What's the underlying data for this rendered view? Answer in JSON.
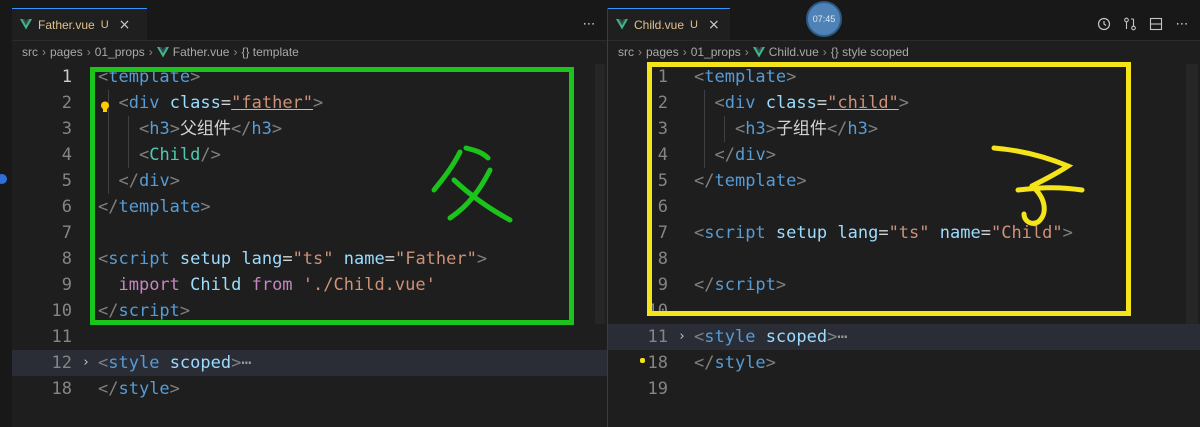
{
  "left": {
    "tab": {
      "name": "Father.vue",
      "status": "U"
    },
    "breadcrumb": [
      "src",
      "pages",
      "01_props",
      "Father.vue",
      "{} template"
    ],
    "lines": [
      {
        "n": "1",
        "tokens": [
          [
            "b",
            "<"
          ],
          [
            "tag",
            "template"
          ],
          [
            "b",
            ">"
          ]
        ]
      },
      {
        "n": "2",
        "tokens": [
          [
            "txt",
            "  "
          ],
          [
            "b",
            "<"
          ],
          [
            "tag",
            "div"
          ],
          [
            "txt",
            " "
          ],
          [
            "attr",
            "class"
          ],
          [
            "txt",
            "="
          ],
          [
            "strU",
            "\"father\""
          ],
          [
            "b",
            ">"
          ]
        ]
      },
      {
        "n": "3",
        "tokens": [
          [
            "txt",
            "    "
          ],
          [
            "b",
            "<"
          ],
          [
            "tag",
            "h3"
          ],
          [
            "b",
            ">"
          ],
          [
            "txt",
            "父组件"
          ],
          [
            "b",
            "</"
          ],
          [
            "tag",
            "h3"
          ],
          [
            "b",
            ">"
          ]
        ]
      },
      {
        "n": "4",
        "tokens": [
          [
            "txt",
            "    "
          ],
          [
            "b",
            "<"
          ],
          [
            "comp",
            "Child"
          ],
          [
            "b",
            "/>"
          ]
        ]
      },
      {
        "n": "5",
        "tokens": [
          [
            "txt",
            "  "
          ],
          [
            "b",
            "</"
          ],
          [
            "tag",
            "div"
          ],
          [
            "b",
            ">"
          ]
        ]
      },
      {
        "n": "6",
        "tokens": [
          [
            "b",
            "</"
          ],
          [
            "tag",
            "template"
          ],
          [
            "b",
            ">"
          ]
        ]
      },
      {
        "n": "7",
        "tokens": []
      },
      {
        "n": "8",
        "tokens": [
          [
            "b",
            "<"
          ],
          [
            "tag",
            "script"
          ],
          [
            "txt",
            " "
          ],
          [
            "attr",
            "setup"
          ],
          [
            "txt",
            " "
          ],
          [
            "attr",
            "lang"
          ],
          [
            "txt",
            "="
          ],
          [
            "str",
            "\"ts\""
          ],
          [
            "txt",
            " "
          ],
          [
            "attr",
            "name"
          ],
          [
            "txt",
            "="
          ],
          [
            "str",
            "\"Father\""
          ],
          [
            "b",
            ">"
          ]
        ]
      },
      {
        "n": "9",
        "tokens": [
          [
            "txt",
            "  "
          ],
          [
            "kw",
            "import"
          ],
          [
            "txt",
            " "
          ],
          [
            "attr",
            "Child"
          ],
          [
            "txt",
            " "
          ],
          [
            "kw",
            "from"
          ],
          [
            "txt",
            " "
          ],
          [
            "str",
            "'./Child.vue'"
          ]
        ]
      },
      {
        "n": "10",
        "tokens": [
          [
            "b",
            "</"
          ],
          [
            "tag",
            "script"
          ],
          [
            "b",
            ">"
          ]
        ]
      },
      {
        "n": "11",
        "tokens": []
      },
      {
        "n": "12",
        "fold": true,
        "tokens": [
          [
            "b",
            "<"
          ],
          [
            "tag",
            "style"
          ],
          [
            "txt",
            " "
          ],
          [
            "attr",
            "scoped"
          ],
          [
            "b",
            ">"
          ],
          [
            "fold",
            "⋯"
          ]
        ]
      },
      {
        "n": "18",
        "tokens": [
          [
            "b",
            "</"
          ],
          [
            "tag",
            "style"
          ],
          [
            "b",
            ">"
          ]
        ]
      }
    ],
    "annotation": "父"
  },
  "right": {
    "tab": {
      "name": "Child.vue",
      "status": "U"
    },
    "breadcrumb": [
      "src",
      "pages",
      "01_props",
      "Child.vue",
      "{} style scoped"
    ],
    "lines": [
      {
        "n": "1",
        "tokens": [
          [
            "b",
            "<"
          ],
          [
            "tag",
            "template"
          ],
          [
            "b",
            ">"
          ]
        ]
      },
      {
        "n": "2",
        "tokens": [
          [
            "txt",
            "  "
          ],
          [
            "b",
            "<"
          ],
          [
            "tag",
            "div"
          ],
          [
            "txt",
            " "
          ],
          [
            "attr",
            "class"
          ],
          [
            "txt",
            "="
          ],
          [
            "strU",
            "\"child\""
          ],
          [
            "b",
            ">"
          ]
        ]
      },
      {
        "n": "3",
        "tokens": [
          [
            "txt",
            "    "
          ],
          [
            "b",
            "<"
          ],
          [
            "tag",
            "h3"
          ],
          [
            "b",
            ">"
          ],
          [
            "txt",
            "子组件"
          ],
          [
            "b",
            "</"
          ],
          [
            "tag",
            "h3"
          ],
          [
            "b",
            ">"
          ]
        ]
      },
      {
        "n": "4",
        "tokens": [
          [
            "txt",
            "  "
          ],
          [
            "b",
            "</"
          ],
          [
            "tag",
            "div"
          ],
          [
            "b",
            ">"
          ]
        ]
      },
      {
        "n": "5",
        "tokens": [
          [
            "b",
            "</"
          ],
          [
            "tag",
            "template"
          ],
          [
            "b",
            ">"
          ]
        ]
      },
      {
        "n": "6",
        "tokens": []
      },
      {
        "n": "7",
        "tokens": [
          [
            "b",
            "<"
          ],
          [
            "tag",
            "script"
          ],
          [
            "txt",
            " "
          ],
          [
            "attr",
            "setup"
          ],
          [
            "txt",
            " "
          ],
          [
            "attr",
            "lang"
          ],
          [
            "txt",
            "="
          ],
          [
            "str",
            "\"ts\""
          ],
          [
            "txt",
            " "
          ],
          [
            "attr",
            "name"
          ],
          [
            "txt",
            "="
          ],
          [
            "str",
            "\"Child\""
          ],
          [
            "b",
            ">"
          ]
        ]
      },
      {
        "n": "8",
        "tokens": []
      },
      {
        "n": "9",
        "tokens": [
          [
            "b",
            "</"
          ],
          [
            "tag",
            "script"
          ],
          [
            "b",
            ">"
          ]
        ]
      },
      {
        "n": "10",
        "tokens": []
      },
      {
        "n": "11",
        "fold": true,
        "tokens": [
          [
            "b",
            "<"
          ],
          [
            "tag",
            "style"
          ],
          [
            "txt",
            " "
          ],
          [
            "attr",
            "scoped"
          ],
          [
            "b",
            ">"
          ],
          [
            "fold",
            "⋯"
          ]
        ]
      },
      {
        "n": "18",
        "tokens": [
          [
            "b",
            "</"
          ],
          [
            "tag",
            "style"
          ],
          [
            "b",
            ">"
          ]
        ]
      },
      {
        "n": "19",
        "tokens": []
      }
    ],
    "annotation": "子"
  },
  "timer_badge": "07:45",
  "icons": {
    "more": "more-actions-icon",
    "history": "timeline-icon",
    "compare": "open-changes-icon",
    "split": "split-editor-icon",
    "overflow": "more-actions-icon"
  },
  "colors": {
    "annotation_left": "#1ac41a",
    "annotation_right": "#f5e41a",
    "tab_accent": "#3794ff",
    "untracked": "#e2c08d"
  }
}
